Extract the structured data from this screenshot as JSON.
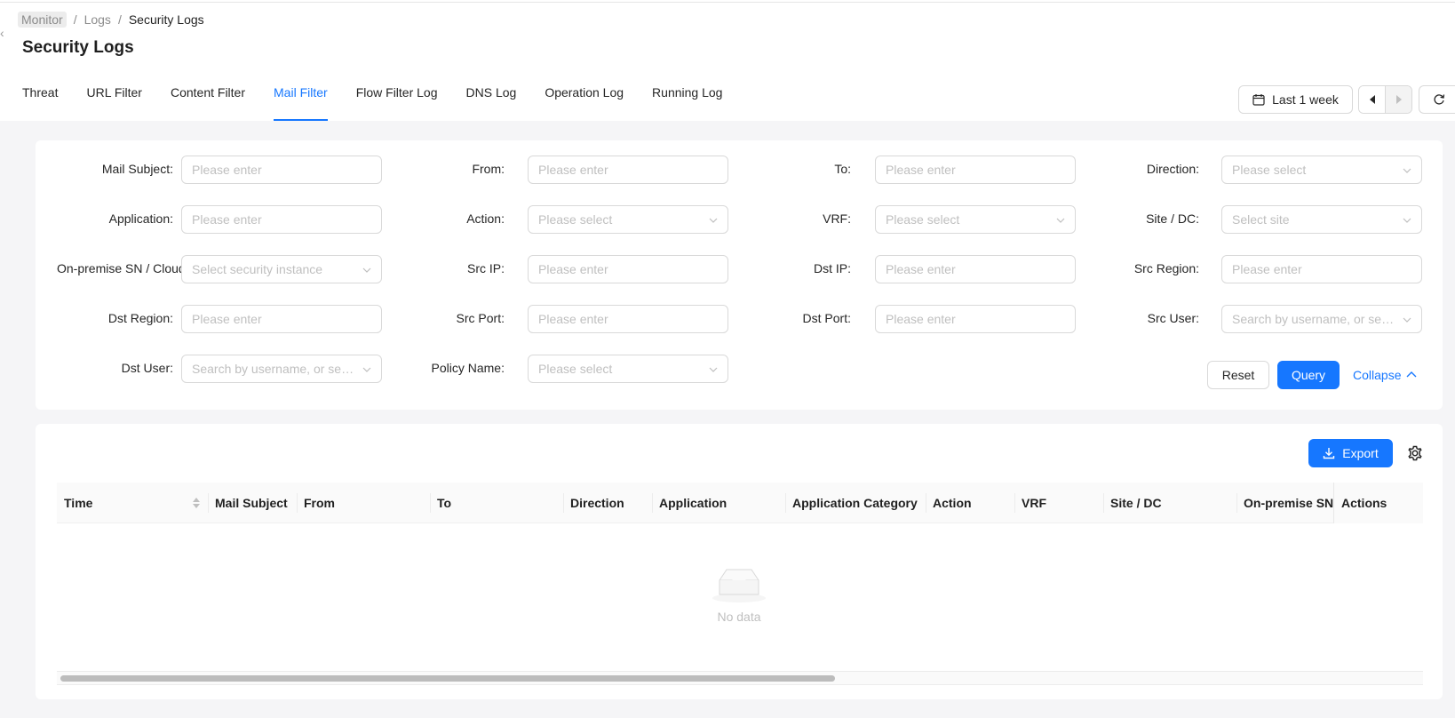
{
  "breadcrumb": {
    "items": [
      "Monitor",
      "Logs",
      "Security Logs"
    ]
  },
  "page": {
    "title": "Security Logs"
  },
  "tabs": [
    {
      "label": "Threat"
    },
    {
      "label": "URL Filter"
    },
    {
      "label": "Content Filter"
    },
    {
      "label": "Mail Filter",
      "active": true
    },
    {
      "label": "Flow Filter Log"
    },
    {
      "label": "DNS Log"
    },
    {
      "label": "Operation Log"
    },
    {
      "label": "Running Log"
    }
  ],
  "toolbar": {
    "range_label": "Last 1 week"
  },
  "filters": {
    "mail_subject": {
      "label": "Mail Subject",
      "placeholder": "Please enter"
    },
    "from": {
      "label": "From",
      "placeholder": "Please enter"
    },
    "to": {
      "label": "To",
      "placeholder": "Please enter"
    },
    "direction": {
      "label": "Direction",
      "placeholder": "Please select"
    },
    "application": {
      "label": "Application",
      "placeholder": "Please enter"
    },
    "action": {
      "label": "Action",
      "placeholder": "Please select"
    },
    "vrf": {
      "label": "VRF",
      "placeholder": "Please select"
    },
    "site": {
      "label": "Site / DC",
      "placeholder": "Select site"
    },
    "onprem": {
      "label": "On-premise SN / Cloud",
      "placeholder": "Select security instance"
    },
    "src_ip": {
      "label": "Src IP",
      "placeholder": "Please enter"
    },
    "dst_ip": {
      "label": "Dst IP",
      "placeholder": "Please enter"
    },
    "src_region": {
      "label": "Src Region",
      "placeholder": "Please enter"
    },
    "dst_region": {
      "label": "Dst Region",
      "placeholder": "Please enter"
    },
    "src_port": {
      "label": "Src Port",
      "placeholder": "Please enter"
    },
    "dst_port": {
      "label": "Dst Port",
      "placeholder": "Please enter"
    },
    "src_user": {
      "label": "Src User",
      "placeholder": "Search by username, or select"
    },
    "dst_user": {
      "label": "Dst User",
      "placeholder": "Search by username, or select"
    },
    "policy_name": {
      "label": "Policy Name",
      "placeholder": "Please select"
    },
    "label_suffix": ":"
  },
  "actions": {
    "reset": "Reset",
    "query": "Query",
    "collapse": "Collapse"
  },
  "table": {
    "export_label": "Export",
    "columns": [
      "Time",
      "Mail Subject",
      "From",
      "To",
      "Direction",
      "Application",
      "Application Category",
      "Action",
      "VRF",
      "Site / DC",
      "On-premise SN",
      "Actions"
    ],
    "empty_text": "No data"
  },
  "colors": {
    "accent": "#1677ff",
    "placeholder": "#bfbfbf",
    "border": "#d9d9d9"
  }
}
